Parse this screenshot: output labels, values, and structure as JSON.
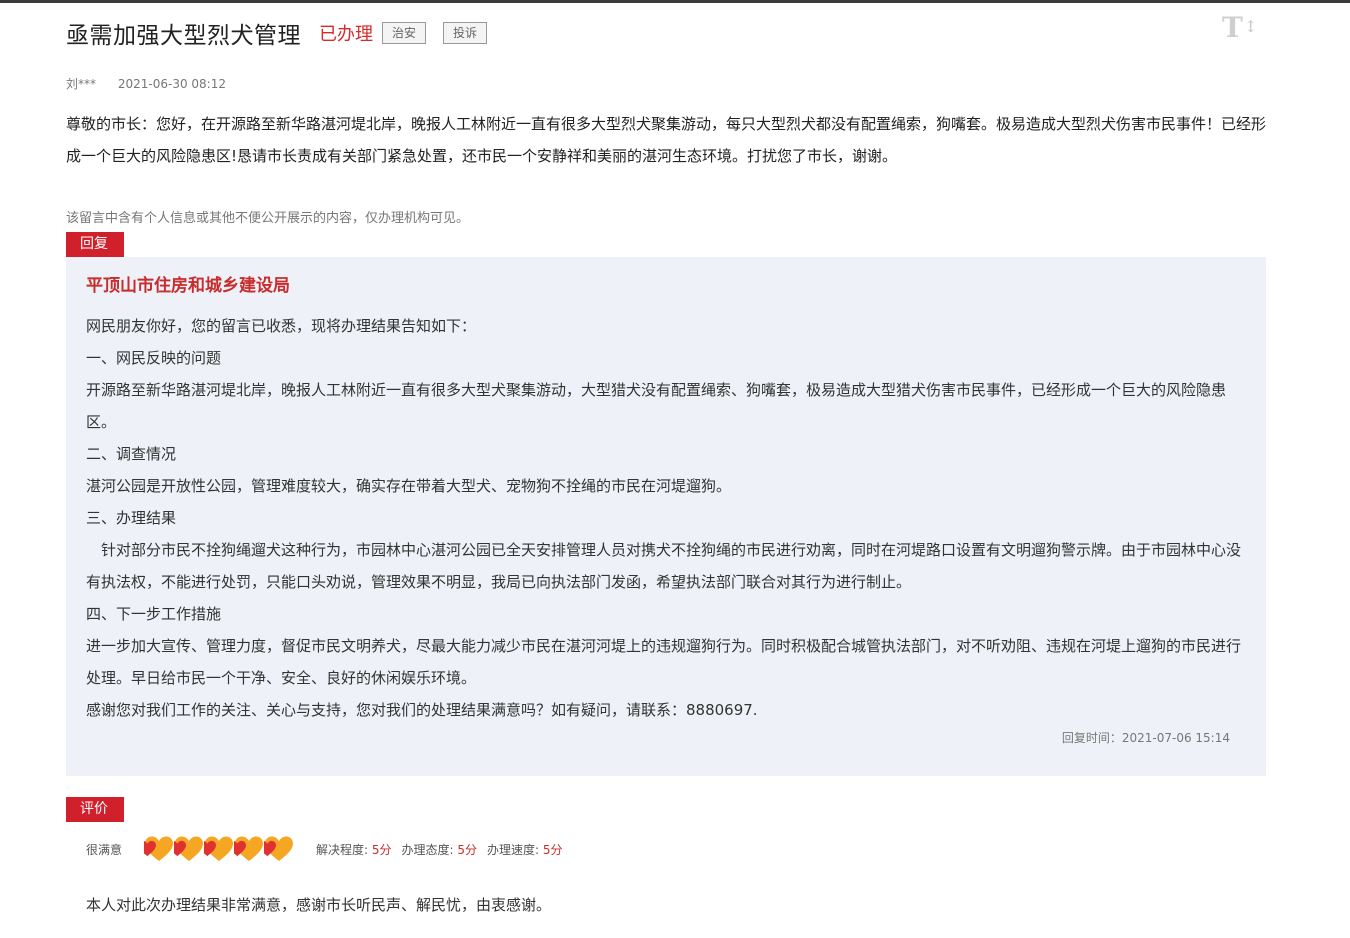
{
  "header": {
    "title": "亟需加强大型烈犬管理",
    "status": "已办理",
    "tags": [
      "治安",
      "投诉"
    ],
    "font_toggle_label": "T"
  },
  "meta": {
    "author": "刘***",
    "date": "2021-06-30 08:12"
  },
  "message": {
    "content": "尊敬的市长：您好，在开源路至新华路湛河堤北岸，晚报人工林附近一直有很多大型烈犬聚集游动，每只大型烈犬都没有配置绳索，狗嘴套。极易造成大型烈犬伤害市民事件！已经形成一个巨大的风险隐患区!恳请市长责成有关部门紧急处置，还市民一个安静祥和美丽的湛河生态环境。打扰您了市长，谢谢。",
    "notice": "该留言中含有个人信息或其他不便公开展示的内容，仅办理机构可见。"
  },
  "reply": {
    "badge": "回复",
    "department": "平顶山市住房和城乡建设局",
    "lines": [
      "网民朋友你好，您的留言已收悉，现将办理结果告知如下：",
      "一、网民反映的问题",
      "开源路至新华路湛河堤北岸，晚报人工林附近一直有很多大型犬聚集游动，大型猎犬没有配置绳索、狗嘴套，极易造成大型猎犬伤害市民事件，已经形成一个巨大的风险隐患区。",
      "二、调查情况",
      "湛河公园是开放性公园，管理难度较大，确实存在带着大型犬、宠物狗不拴绳的市民在河堤遛狗。",
      "三、办理结果",
      "　针对部分市民不拴狗绳遛犬这种行为，市园林中心湛河公园已全天安排管理人员对携犬不拴狗绳的市民进行劝离，同时在河堤路口设置有文明遛狗警示牌。由于市园林中心没有执法权，不能进行处罚，只能口头劝说，管理效果不明显，我局已向执法部门发函，希望执法部门联合对其行为进行制止。",
      "四、下一步工作措施",
      "进一步加大宣传、管理力度，督促市民文明养犬，尽最大能力减少市民在湛河河堤上的违规遛狗行为。同时积极配合城管执法部门，对不听劝阻、违规在河堤上遛狗的市民进行处理。早日给市民一个干净、安全、良好的休闲娱乐环境。",
      "感谢您对我们工作的关注、关心与支持，您对我们的处理结果满意吗？如有疑问，请联系：8880697."
    ],
    "time_label": "回复时间：",
    "time": "2021-07-06 15:14"
  },
  "evaluation": {
    "badge": "评价",
    "level": "很满意",
    "hearts": 5,
    "scores": [
      {
        "label": "解决程度:",
        "value": "5分"
      },
      {
        "label": "办理态度:",
        "value": "5分"
      },
      {
        "label": "办理速度:",
        "value": "5分"
      }
    ],
    "comment": "本人对此次办理结果非常满意，感谢市长听民声、解民忧，由衷感谢。"
  },
  "colors": {
    "accent_red": "#d0202c",
    "heart_orange": "#f5a623",
    "heart_red": "#e03030",
    "reply_bg": "#eef1f7"
  }
}
